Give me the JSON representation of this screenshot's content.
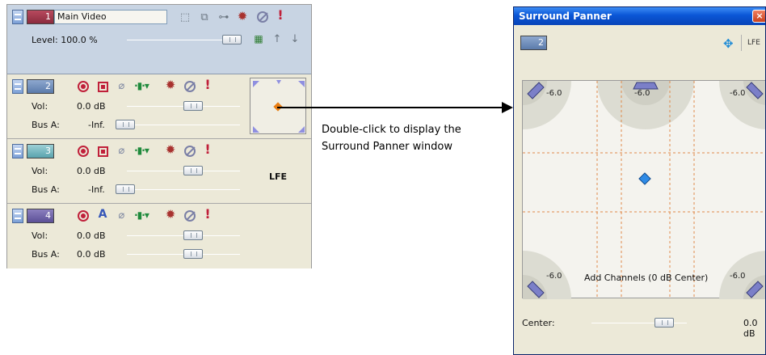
{
  "tracks": [
    {
      "number": "1",
      "name": "Main Video",
      "level_label": "Level:",
      "level_value": "100.0 %"
    },
    {
      "number": "2",
      "vol_label": "Vol:",
      "vol_value": "0.0 dB",
      "bus_label": "Bus A:",
      "bus_value": "-Inf."
    },
    {
      "number": "3",
      "vol_label": "Vol:",
      "vol_value": "0.0 dB",
      "bus_label": "Bus A:",
      "bus_value": "-Inf.",
      "lfe_label": "LFE"
    },
    {
      "number": "4",
      "vol_label": "Vol:",
      "vol_value": "0.0 dB",
      "bus_label": "Bus A:",
      "bus_value": "0.0 dB"
    }
  ],
  "caption": "Double-click to display the Surround Panner window",
  "panner": {
    "title": "Surround Panner",
    "close_label": "×",
    "track_number": "2",
    "lfe_label": "LFE",
    "speaker_levels": {
      "front_left": "-6.0",
      "center": "-6.0",
      "front_right": "-6.0",
      "rear_left": "-6.0",
      "rear_right": "-6.0"
    },
    "add_channels_text": "Add Channels (0 dB Center)",
    "center_label": "Center:",
    "center_value": "0.0 dB"
  },
  "colors": {
    "video_track": "#8b2b3e",
    "track2": "#5b7bab",
    "track3": "#5aa3ad",
    "track4": "#5b4f96",
    "panner_point": "#2f8be6",
    "grid_dash": "#e08a4a",
    "titlebar": "#0a56d6"
  }
}
